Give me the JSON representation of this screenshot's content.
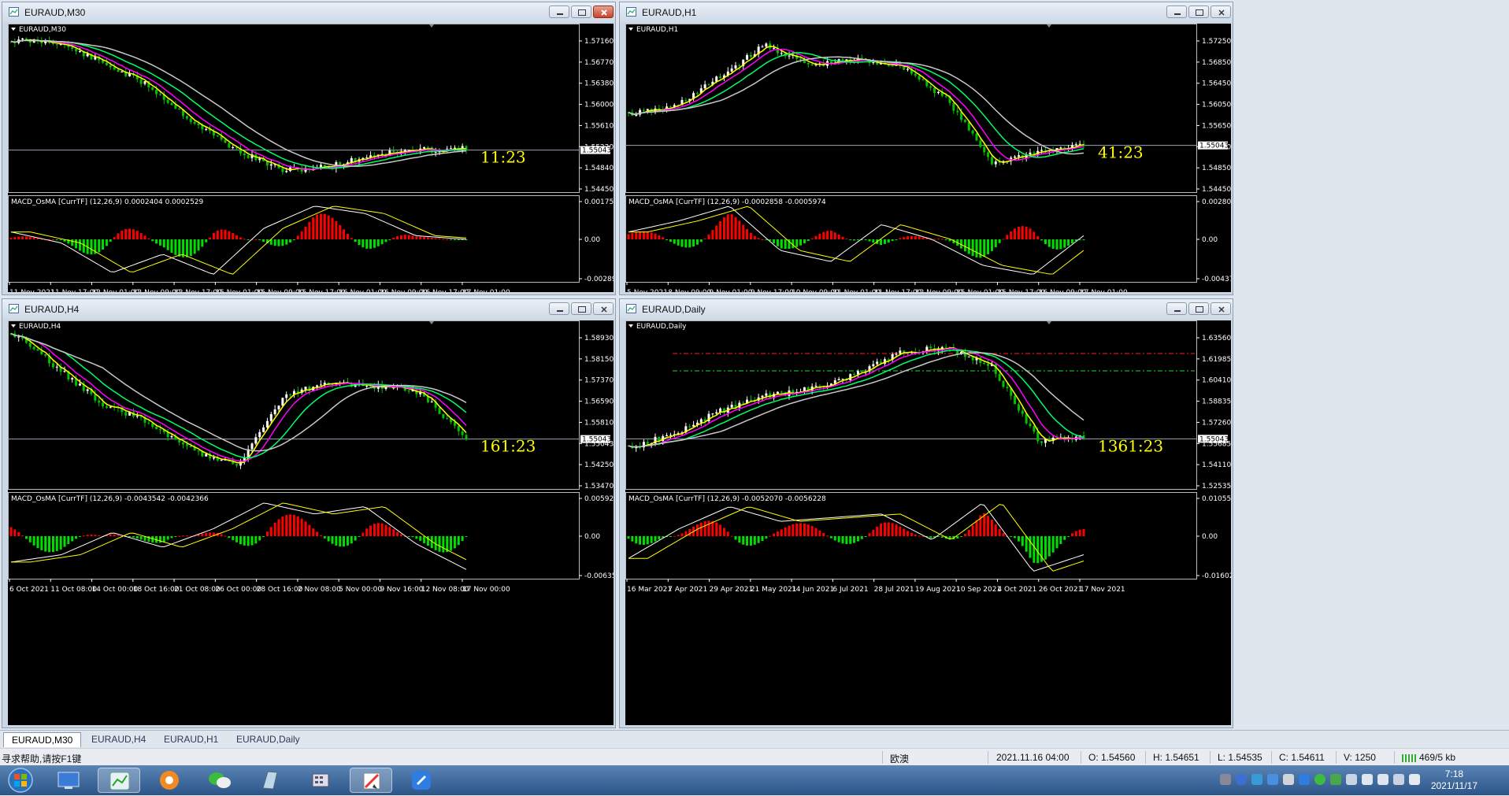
{
  "windows": [
    {
      "title": "EURAUD,M30",
      "label": "EURAUD,M30",
      "macd": "MACD_OsMA [CurrTF] (12,26,9) 0.0002404 0.0002529",
      "timer": "11:23",
      "current": "1.55043",
      "prices": [
        "1.57160",
        "1.56770",
        "1.56380",
        "1.56000",
        "1.55610",
        "1.55220",
        "1.54840",
        "1.54450"
      ],
      "macd_ticks": [
        "0.0017592",
        "0.00",
        "-0.002893"
      ],
      "dates": [
        "11 Nov 2021",
        "11 Nov 17:00",
        "12 Nov 01:00",
        "12 Nov 09:00",
        "12 Nov 17:00",
        "15 Nov 01:00",
        "15 Nov 09:00",
        "15 Nov 17:00",
        "16 Nov 01:00",
        "16 Nov 09:00",
        "16 Nov 17:00",
        "17 Nov 01:00"
      ]
    },
    {
      "title": "EURAUD,H1",
      "label": "EURAUD,H1",
      "macd": "MACD_OsMA [CurrTF] (12,26,9) -0.0002858 -0.0005974",
      "timer": "41:23",
      "current": "1.55043",
      "prices": [
        "1.57250",
        "1.56850",
        "1.56450",
        "1.56050",
        "1.55650",
        "1.55250",
        "1.54850",
        "1.54450"
      ],
      "macd_ticks": [
        "0.0028077",
        "0.00",
        "-0.004378"
      ],
      "dates": [
        "5 Nov 2021",
        "8 Nov 09:00",
        "9 Nov 01:00",
        "9 Nov 17:00",
        "10 Nov 09:00",
        "11 Nov 01:00",
        "11 Nov 17:00",
        "12 Nov 09:00",
        "15 Nov 01:00",
        "15 Nov 17:00",
        "16 Nov 09:00",
        "17 Nov 01:00"
      ]
    },
    {
      "title": "EURAUD,H4",
      "label": "EURAUD,H4",
      "macd": "MACD_OsMA [CurrTF] (12,26,9) -0.0043542 -0.0042366",
      "timer": "161:23",
      "current": "1.55043",
      "prices": [
        "1.58930",
        "1.58150",
        "1.57370",
        "1.56590",
        "1.55810",
        "1.55043",
        "1.54250",
        "1.53470"
      ],
      "macd_ticks": [
        "0.0059253",
        "0.00",
        "-0.006352"
      ],
      "dates": [
        "6 Oct 2021",
        "11 Oct 08:00",
        "14 Oct 00:00",
        "18 Oct 16:00",
        "21 Oct 08:00",
        "26 Oct 00:00",
        "28 Oct 16:00",
        "2 Nov 08:00",
        "5 Nov 00:00",
        "9 Nov 16:00",
        "12 Nov 08:00",
        "17 Nov 00:00"
      ]
    },
    {
      "title": "EURAUD,Daily",
      "label": "EURAUD,Daily",
      "macd": "MACD_OsMA [CurrTF] (12,26,9) -0.0052070 -0.0056228",
      "timer": "1361:23",
      "current": "1.55043",
      "prices": [
        "1.63560",
        "1.61985",
        "1.60410",
        "1.58835",
        "1.57260",
        "1.55685",
        "1.54110",
        "1.52535"
      ],
      "macd_ticks": [
        "0.0105568",
        "0.00",
        "-0.016028"
      ],
      "dates": [
        "16 Mar 2021",
        "7 Apr 2021",
        "29 Apr 2021",
        "21 May 2021",
        "14 Jun 2021",
        "6 Jul 2021",
        "28 Jul 2021",
        "19 Aug 2021",
        "10 Sep 2021",
        "4 Oct 2021",
        "26 Oct 2021",
        "17 Nov 2021"
      ]
    }
  ],
  "tabs": [
    "EURAUD,M30",
    "EURAUD,H4",
    "EURAUD,H1",
    "EURAUD,Daily"
  ],
  "status": {
    "help": "寻求帮助,请按F1键",
    "profile": "欧澳",
    "datetime": "2021.11.16 04:00",
    "open": "O: 1.54560",
    "high": "H: 1.54651",
    "low": "L: 1.54535",
    "close": "C: 1.54611",
    "volume": "V: 1250",
    "traffic": "469/5 kb"
  },
  "taskbar": {
    "time": "7:18",
    "date": "2021/11/17",
    "icons": [
      "start-orb-icon",
      "desktop-icon",
      "metatrader-icon",
      "browser-icon",
      "wechat-icon",
      "notes-icon",
      "calculator-icon",
      "paint-icon",
      "feishu-icon"
    ]
  },
  "colors": {
    "bull": "#ffffff",
    "bear": "#00c000",
    "ma_fast": "#ffff00",
    "ma_mid": "#ff00ff",
    "ma_slow": "#00ff66",
    "ma_long": "#c8c8c8",
    "osma_up": "#ff0000",
    "osma_dn": "#00e000",
    "timer": "#ffff00"
  }
}
